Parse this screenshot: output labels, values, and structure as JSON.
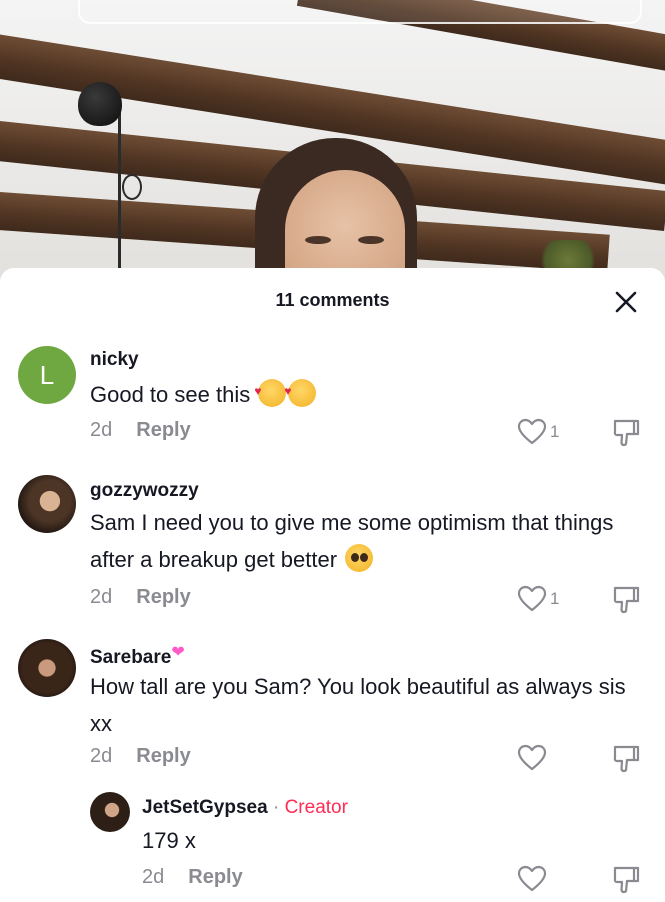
{
  "sheet": {
    "title": "11 comments"
  },
  "comments": [
    {
      "avatar_letter": "L",
      "username": "nicky",
      "text": "Good to see this",
      "emoji": [
        "smiling-face-with-hearts",
        "smiling-face-with-hearts"
      ],
      "age": "2d",
      "reply_label": "Reply",
      "likes": "1"
    },
    {
      "username": "gozzywozzy",
      "text": "Sam I need you to give me some optimism that things after a breakup get better",
      "emoji": [
        "pleading-face"
      ],
      "age": "2d",
      "reply_label": "Reply",
      "likes": "1"
    },
    {
      "username": "Sarebare",
      "username_emoji": "pink-heart",
      "text": "How tall are you Sam? You look beautiful as always sis xx",
      "age": "2d",
      "reply_label": "Reply",
      "likes": ""
    }
  ],
  "reply": {
    "username": "JetSetGypsea",
    "separator": " · ",
    "badge": "Creator",
    "text": "179 x",
    "age": "2d",
    "reply_label": "Reply",
    "likes": ""
  },
  "colors": {
    "creator_badge": "#fe2c55",
    "meta_gray": "#8a8b91",
    "avatar_green": "#6fa740"
  },
  "icons": {
    "close": "close-icon",
    "like": "heart-outline-icon",
    "dislike": "thumbs-down-outline-icon"
  }
}
